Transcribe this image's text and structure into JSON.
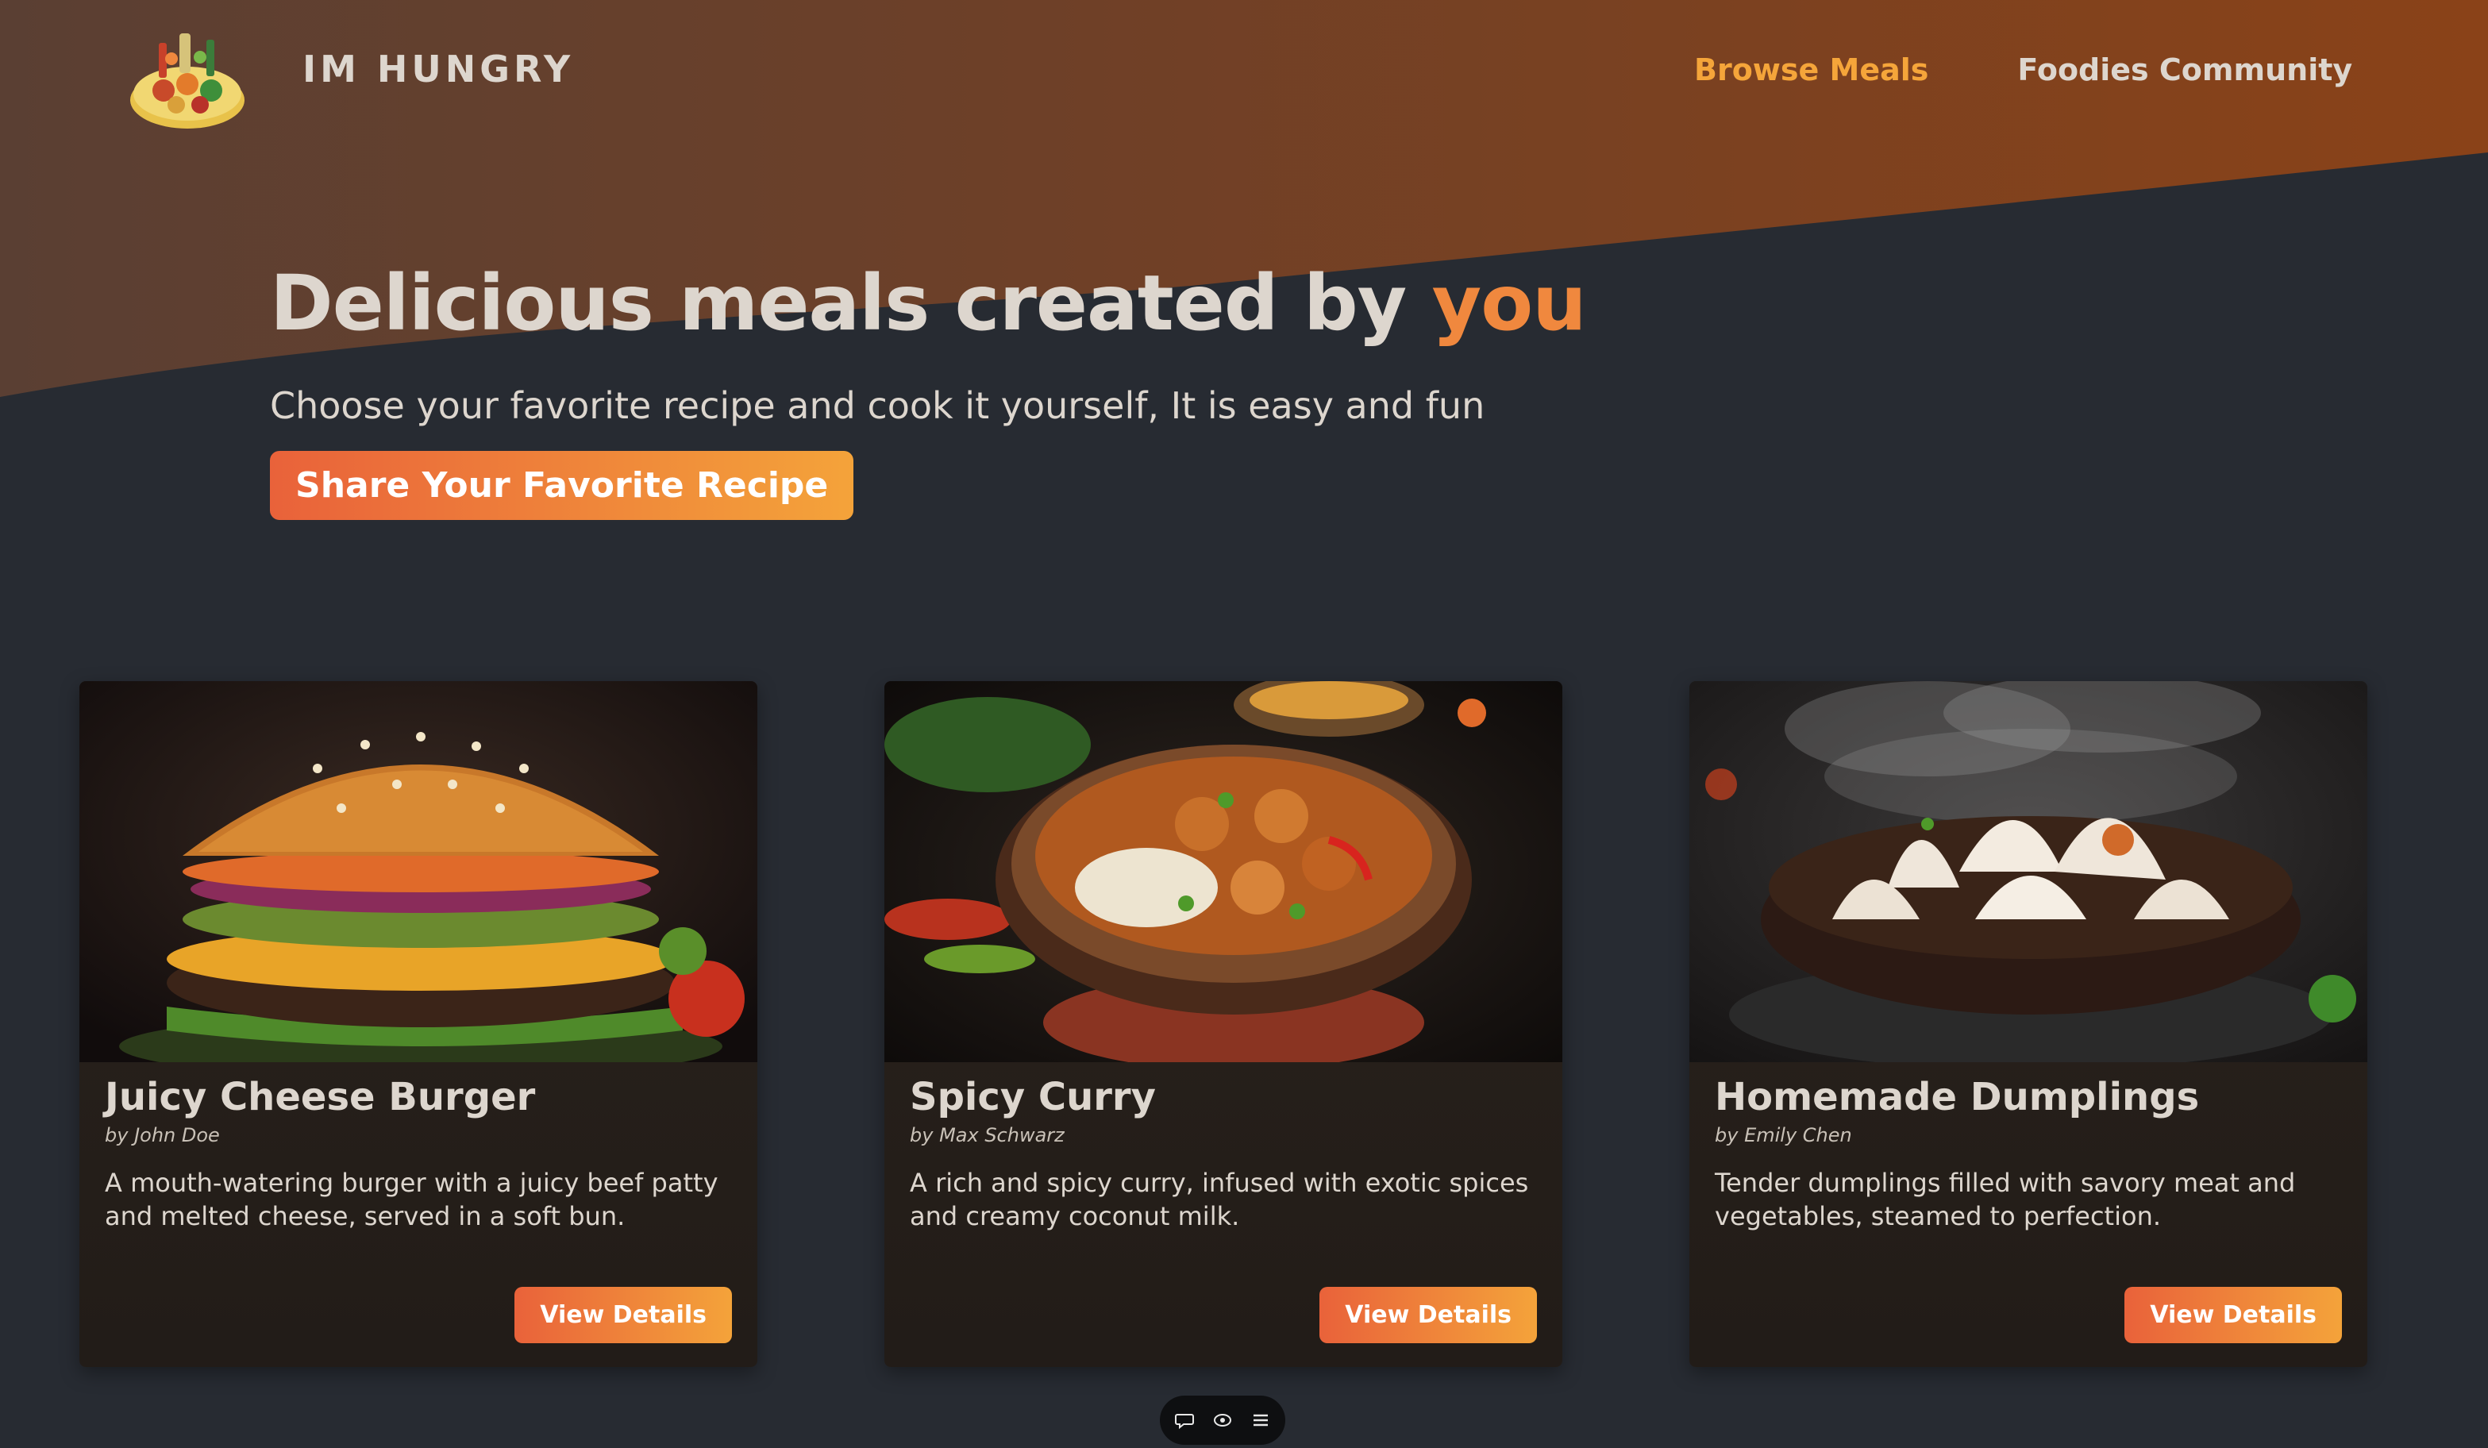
{
  "header": {
    "brand": "IM HUNGRY",
    "logo_icon": "food-platter-icon",
    "nav": [
      {
        "label": "Browse Meals",
        "active": true
      },
      {
        "label": "Foodies Community",
        "active": false
      }
    ]
  },
  "hero": {
    "title_main": "Delicious meals created by ",
    "title_accent": "you",
    "subtitle": "Choose your favorite recipe and cook it yourself, It is easy and fun",
    "cta_label": "Share Your Favorite Recipe"
  },
  "meals": [
    {
      "title": "Juicy Cheese Burger",
      "author": "by John Doe",
      "description": "A mouth-watering burger with a juicy beef patty and melted cheese, served in a soft bun.",
      "button": "View Details",
      "image_icon": "burger-image"
    },
    {
      "title": "Spicy Curry",
      "author": "by Max Schwarz",
      "description": "A rich and spicy curry, infused with exotic spices and creamy coconut milk.",
      "button": "View Details",
      "image_icon": "curry-image"
    },
    {
      "title": "Homemade Dumplings",
      "author": "by Emily Chen",
      "description": "Tender dumplings filled with savory meat and vegetables, steamed to perfection.",
      "button": "View Details",
      "image_icon": "dumplings-image"
    }
  ],
  "dock": {
    "icons": [
      "chat-icon",
      "eye-icon",
      "menu-icon"
    ]
  },
  "colors": {
    "background": "#272b32",
    "header_gradient_start": "#5a3f33",
    "header_gradient_end": "#8a4218",
    "accent": "#f0883e",
    "nav_active": "#f5a53a",
    "button_start": "#e9623a",
    "button_end": "#f4a33a",
    "text": "#ddd6ce"
  }
}
